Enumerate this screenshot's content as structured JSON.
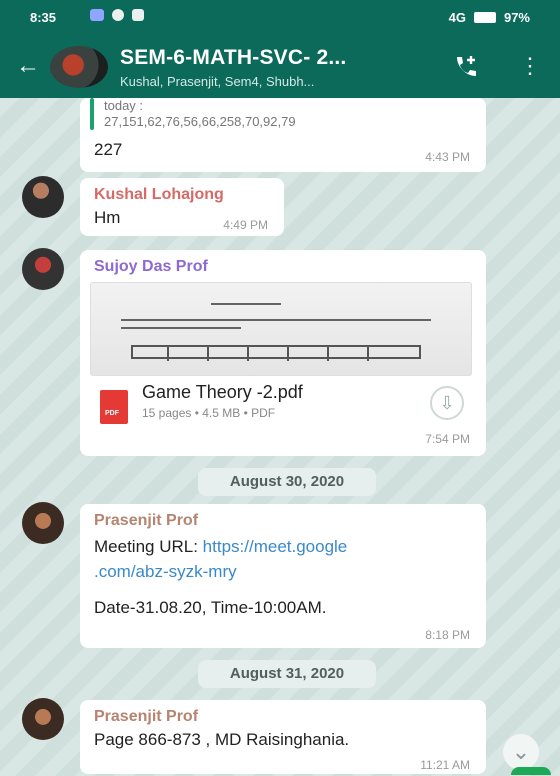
{
  "status_bar": {
    "time": "8:35",
    "signal_text": "4G",
    "battery": "97%"
  },
  "chat_header": {
    "title": "SEM-6-MATH-SVC- 2...",
    "participants": "Kushal, Prasenjit, Sem4, Shubh..."
  },
  "messages": [
    {
      "quote_lines": [
        "today :",
        "27,151,62,76,56,66,258,70,92,79"
      ],
      "text": "227",
      "time": "4:43 PM"
    },
    {
      "sender": "Kushal Lohajong",
      "sender_color": "#d66a66",
      "text": "Hm",
      "time": "4:49 PM"
    },
    {
      "sender": "Sujoy Das Prof",
      "sender_color": "#8d6ad0",
      "document": {
        "name": "Game Theory -2.pdf",
        "meta": "15 pages • 4.5 MB • PDF",
        "type_label": "PDF"
      },
      "time": "7:54 PM"
    },
    {
      "sender": "Prasenjit Prof",
      "sender_color": "#b58572",
      "text_prefix": "Meeting URL: ",
      "link_line1": "https://meet.google",
      "link_line2": ".com/abz-syzk-mry",
      "text_date": "Date-31.08.20, Time-10:00AM.",
      "time": "8:18 PM"
    },
    {
      "sender": "Prasenjit Prof",
      "sender_color": "#b58572",
      "text": "Page 866-873 , MD Raisinghania.",
      "time": "11:21 AM"
    }
  ],
  "date_chips": [
    "August 30, 2020",
    "August 31, 2020"
  ]
}
